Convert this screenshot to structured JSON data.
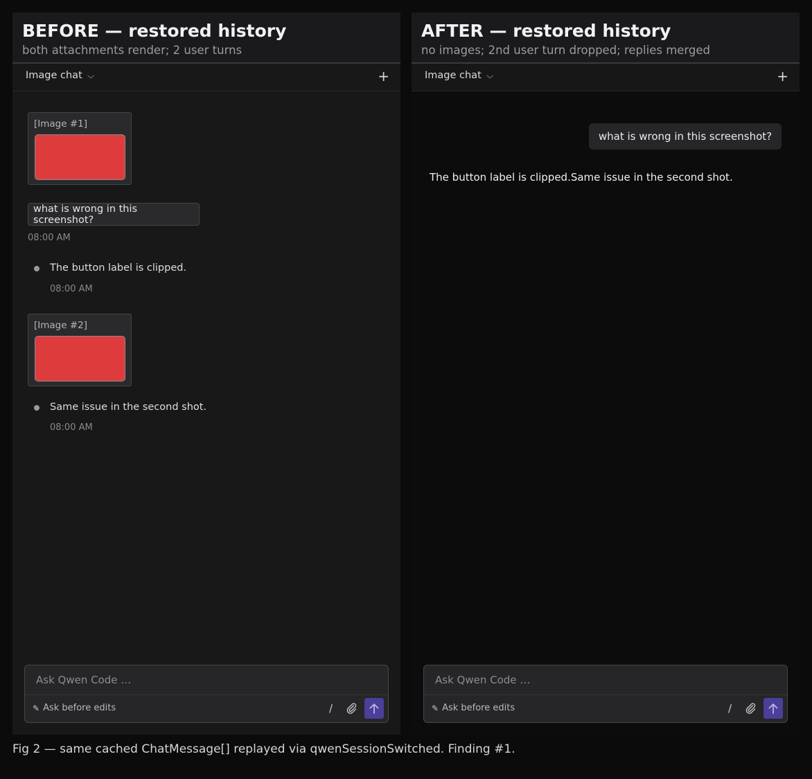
{
  "before": {
    "title": "BEFORE — restored history",
    "subtitle": "both attachments render; 2 user turns",
    "chat_select": "Image chat",
    "messages": {
      "image1_label": "[Image #1]",
      "user1": "what is wrong in this screenshot?",
      "user1_time": "08:00 AM",
      "reply1": "The button label is clipped.",
      "reply1_time": "08:00 AM",
      "image2_label": "[Image #2]",
      "reply2": "Same issue in the second shot.",
      "reply2_time": "08:00 AM"
    },
    "composer": {
      "placeholder": "Ask Qwen Code …",
      "mode": "Ask before edits",
      "slash": "/"
    }
  },
  "after": {
    "title": "AFTER — restored history",
    "subtitle": "no images; 2nd user turn dropped; replies merged",
    "chat_select": "Image chat",
    "messages": {
      "user1": "what is wrong in this screenshot?",
      "reply_merged": "The button label is clipped.Same issue in the second shot."
    },
    "composer": {
      "placeholder": "Ask Qwen Code …",
      "mode": "Ask before edits",
      "slash": "/"
    }
  },
  "caption": "Fig 2 — same cached ChatMessage[] replayed via qwenSessionSwitched. Finding #1.",
  "colors": {
    "image_thumb": "#de3c3c",
    "send_button": "#4a3f99"
  }
}
